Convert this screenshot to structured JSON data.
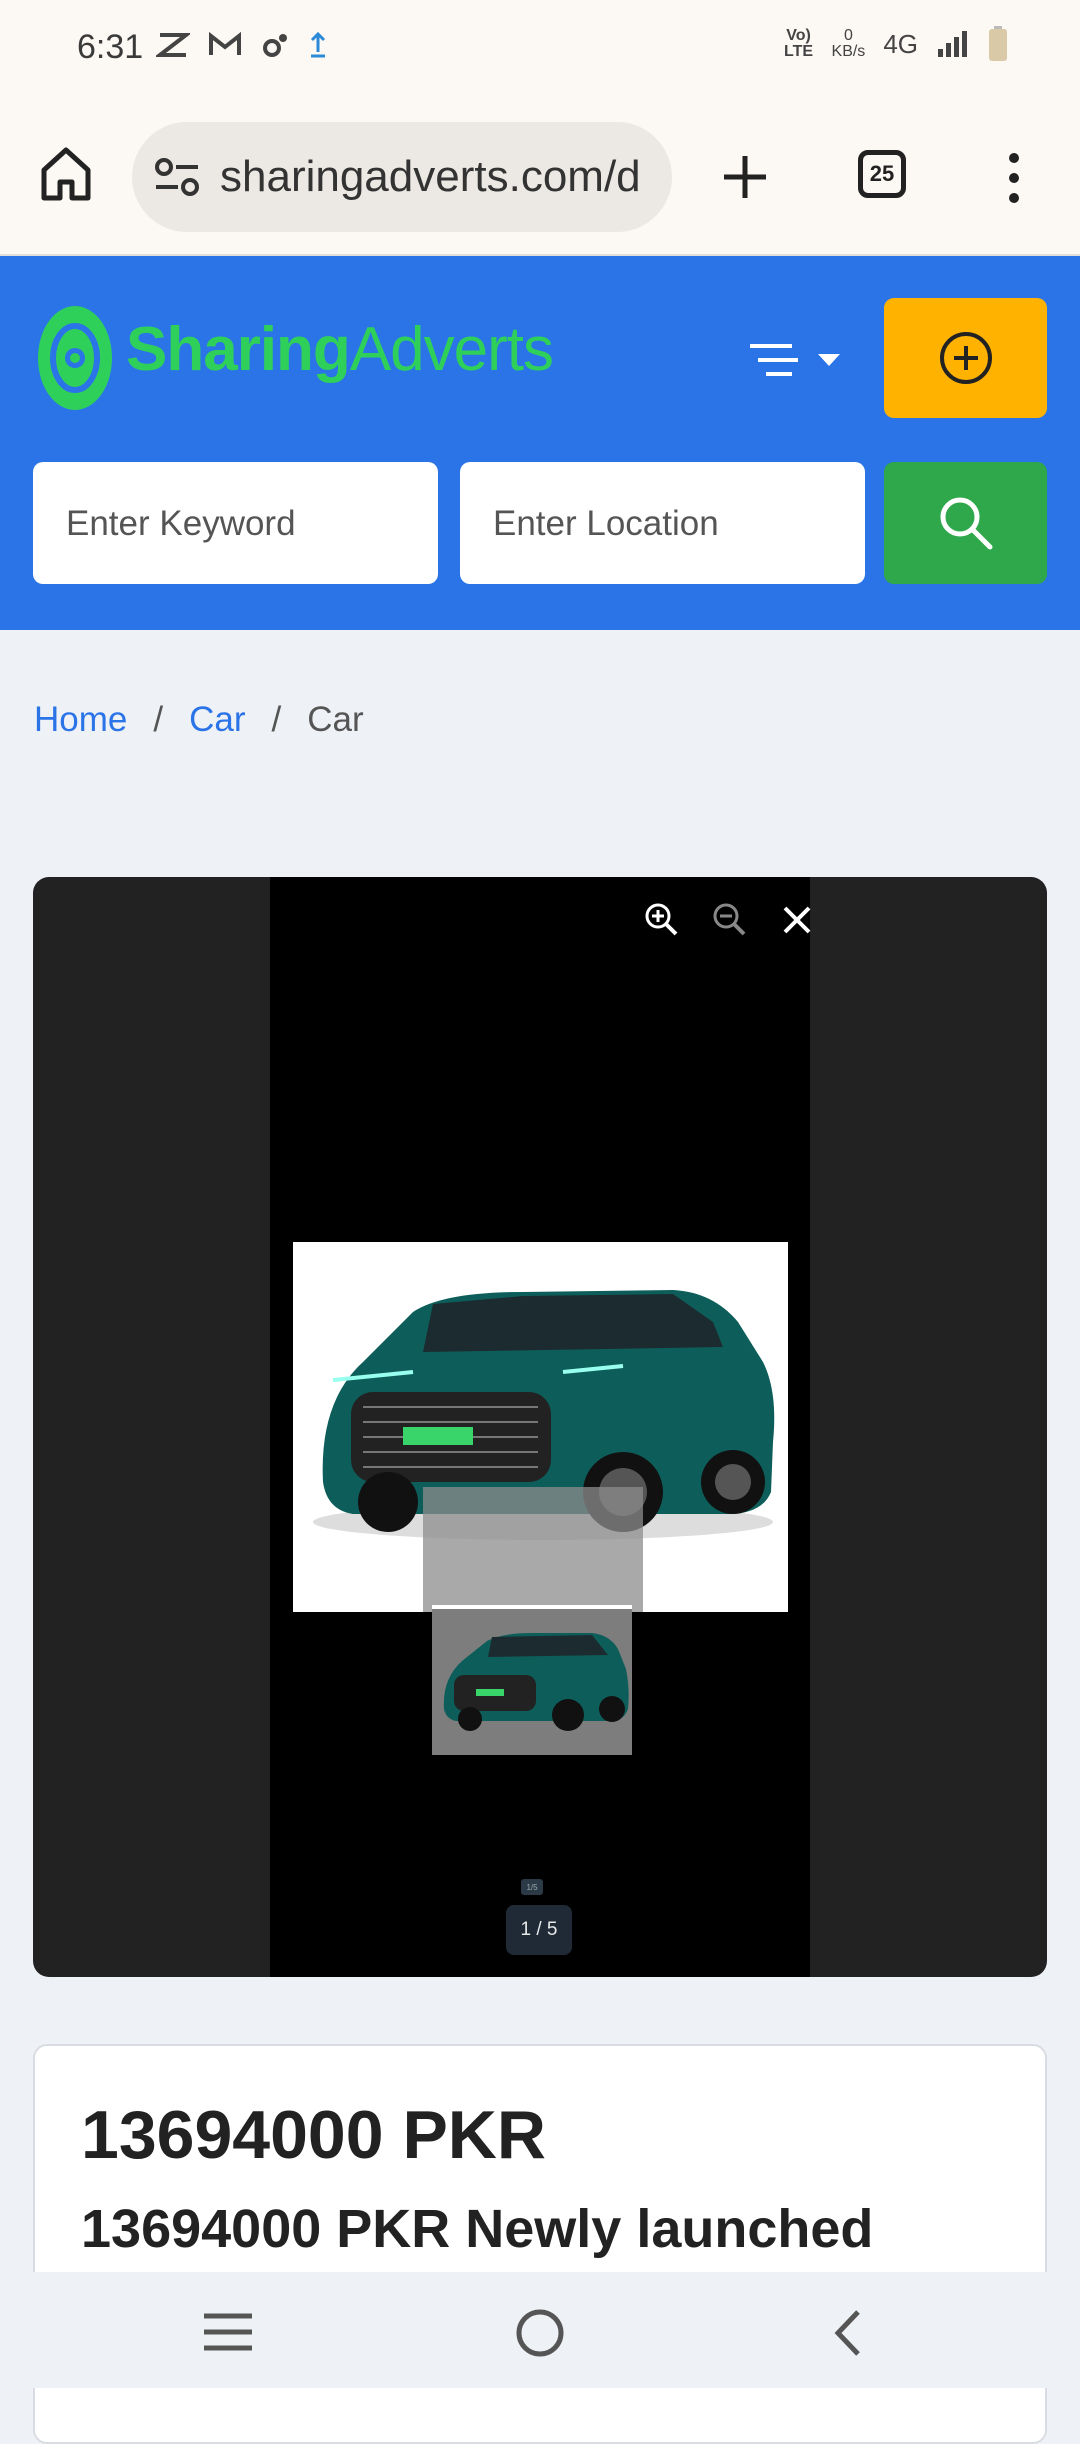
{
  "status_bar": {
    "time": "6:31",
    "left_icons": [
      "notification-icon",
      "gmail-icon",
      "settings-sync-icon",
      "upload-icon"
    ],
    "volte_label": "Vo) LTE",
    "data_speed_value": "0",
    "data_speed_unit": "KB/s",
    "network": "4G"
  },
  "browser": {
    "url": "sharingadverts.com/d",
    "tab_count": "25"
  },
  "site_header": {
    "logo_text_1": "Sharing",
    "logo_text_2": "Adverts",
    "keyword_placeholder": "Enter Keyword",
    "location_placeholder": "Enter Location",
    "colors": {
      "header_bg": "#2b74e8",
      "add_button": "#ffb300",
      "search_button": "#2ea84a",
      "logo": "#2fd05a"
    }
  },
  "breadcrumb": {
    "items": [
      "Home",
      "Car",
      "Car"
    ],
    "separator": "/"
  },
  "gallery": {
    "counter": "1 / 5",
    "controls": [
      "zoom-in-icon",
      "zoom-out-icon",
      "close-icon"
    ]
  },
  "listing": {
    "price": "13694000 PKR",
    "title": "13694000 PKR Newly launched"
  }
}
